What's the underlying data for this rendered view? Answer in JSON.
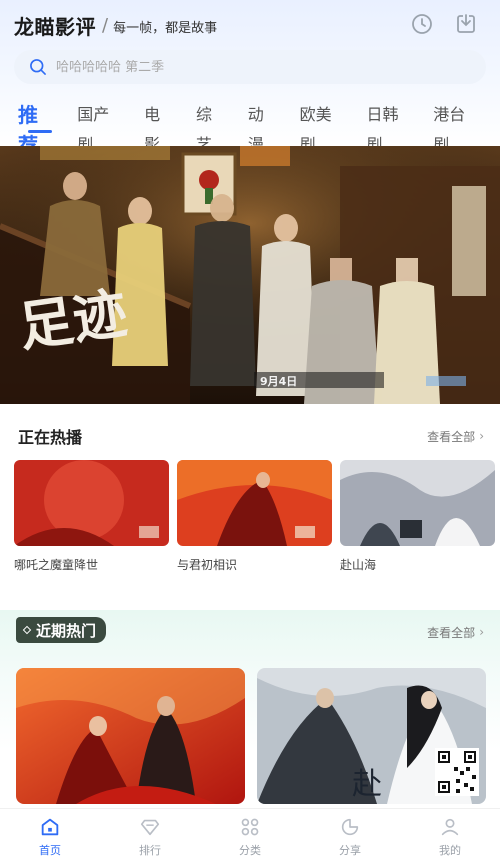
{
  "header": {
    "app_title": "龙瞄影评",
    "tagline": "每一帧，都是故事",
    "history_icon": "clock-icon",
    "download_icon": "download-icon"
  },
  "search": {
    "placeholder": "哈哈哈哈哈 第二季",
    "icon": "search-icon"
  },
  "tabs": [
    {
      "label": "推荐",
      "active": true
    },
    {
      "label": "国产剧"
    },
    {
      "label": "电影"
    },
    {
      "label": "综艺"
    },
    {
      "label": "动漫"
    },
    {
      "label": "欧美剧"
    },
    {
      "label": "日韩剧"
    },
    {
      "label": "港台剧"
    }
  ],
  "banner": {
    "poster_text": "足迹",
    "date_badge": "9月4日"
  },
  "hot_section": {
    "title": "正在热播",
    "more": "查看全部",
    "items": [
      {
        "name": "哪吒之魔童降世"
      },
      {
        "name": "与君初相识"
      },
      {
        "name": "赴山海"
      }
    ]
  },
  "recent_section": {
    "title": "近期热门",
    "more": "查看全部",
    "posters": [
      {
        "title": ""
      },
      {
        "title": "赴"
      }
    ]
  },
  "bottom_nav": [
    {
      "label": "首页",
      "icon": "home-icon",
      "active": true
    },
    {
      "label": "排行",
      "icon": "diamond-icon"
    },
    {
      "label": "分类",
      "icon": "grid-icon"
    },
    {
      "label": "分享",
      "icon": "share-icon"
    },
    {
      "label": "我的",
      "icon": "user-icon"
    }
  ],
  "colors": {
    "accent": "#2f6cf5",
    "badge_bg": "#3a4a3f"
  }
}
